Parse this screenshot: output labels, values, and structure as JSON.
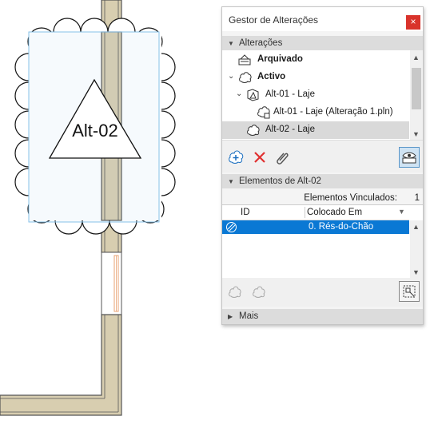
{
  "drawing": {
    "tag_label": "Alt-02",
    "colors": {
      "wall": "#d8ceb0",
      "wall_edge": "#555555",
      "cloud": "#111111",
      "highlight": "#86c1e8"
    }
  },
  "panel": {
    "title": "Gestor de Alterações",
    "close_glyph": "×",
    "changes_section": "Alterações",
    "tree": [
      {
        "label": "Arquivado",
        "bold": true
      },
      {
        "label": "Activo",
        "bold": true
      },
      {
        "label": "Alt-01 - Laje",
        "bold": false
      },
      {
        "label": "Alt-01 - Laje (Alteração 1.pln)",
        "bold": false
      },
      {
        "label": "Alt-02 - Laje",
        "bold": false,
        "selected": true
      }
    ],
    "elements_section": "Elementos de Alt-02",
    "linked_label": "Elementos Vinculados:",
    "linked_count": "1",
    "table": {
      "headers": [
        "ID",
        "Colocado Em"
      ],
      "rows": [
        {
          "id": "",
          "placed": "0. Rés-do-Chão"
        }
      ]
    },
    "more_section": "Mais",
    "icons": {
      "add": "add-change-icon",
      "delete": "delete-icon",
      "link": "link-icon",
      "show": "show-marker-icon"
    }
  }
}
